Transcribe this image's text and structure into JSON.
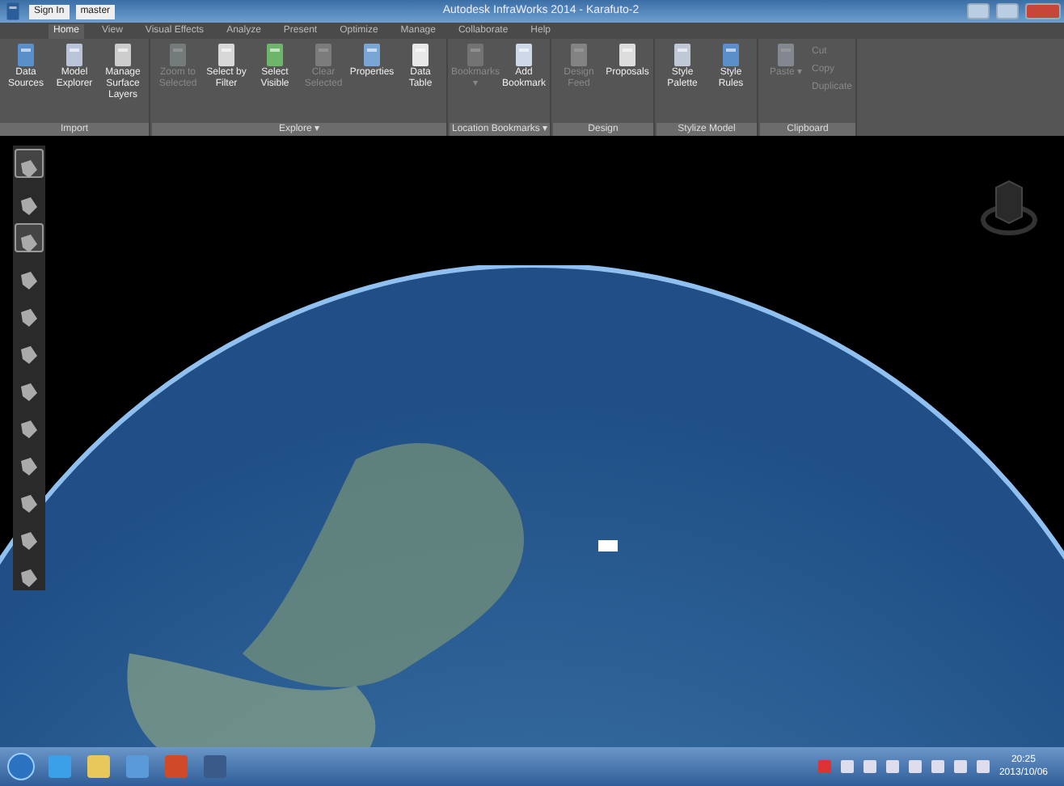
{
  "window": {
    "title": "Autodesk InfraWorks 2014 - Karafuto-2"
  },
  "quick_access": {
    "sign_in": "Sign In",
    "proposal": "master"
  },
  "tabs": [
    {
      "label": "Home",
      "selected": true
    },
    {
      "label": "View",
      "selected": false
    },
    {
      "label": "Visual Effects",
      "selected": false
    },
    {
      "label": "Analyze",
      "selected": false
    },
    {
      "label": "Present",
      "selected": false
    },
    {
      "label": "Optimize",
      "selected": false
    },
    {
      "label": "Manage",
      "selected": false
    },
    {
      "label": "Collaborate",
      "selected": false
    },
    {
      "label": "Help",
      "selected": false
    }
  ],
  "ribbon_groups": [
    {
      "label": "Import",
      "tools": [
        {
          "label": "Data Sources",
          "disabled": false
        },
        {
          "label": "Model Explorer",
          "disabled": false
        },
        {
          "label": "Manage Surface Layers",
          "disabled": false
        }
      ]
    },
    {
      "label": "Explore ▾",
      "tools": [
        {
          "label": "Zoom to Selected",
          "disabled": true
        },
        {
          "label": "Select by Filter",
          "disabled": false
        },
        {
          "label": "Select Visible",
          "disabled": false
        },
        {
          "label": "Clear Selected",
          "disabled": true
        },
        {
          "label": "Properties",
          "disabled": false
        },
        {
          "label": "Data Table",
          "disabled": false
        }
      ]
    },
    {
      "label": "Location Bookmarks ▾",
      "tools": [
        {
          "label": "Bookmarks ▾",
          "disabled": true
        },
        {
          "label": "Add Bookmark",
          "disabled": false
        }
      ]
    },
    {
      "label": "Design",
      "tools": [
        {
          "label": "Design Feed",
          "disabled": true
        },
        {
          "label": "Proposals",
          "disabled": false
        }
      ]
    },
    {
      "label": "Stylize Model",
      "tools": [
        {
          "label": "Style Palette",
          "disabled": false
        },
        {
          "label": "Style Rules",
          "disabled": false
        }
      ]
    },
    {
      "label": "Clipboard",
      "tools": [
        {
          "label": "Paste ▾",
          "disabled": true
        }
      ],
      "small_tools": [
        {
          "label": "Cut",
          "disabled": true
        },
        {
          "label": "Copy",
          "disabled": true
        },
        {
          "label": "Duplicate",
          "disabled": true
        }
      ]
    }
  ],
  "left_toolbar": [
    {
      "selected": true
    },
    {
      "selected": false
    },
    {
      "selected": true
    },
    {
      "selected": false
    },
    {
      "selected": false
    },
    {
      "selected": false
    },
    {
      "selected": false
    },
    {
      "selected": false
    },
    {
      "selected": false
    },
    {
      "selected": false
    },
    {
      "selected": false
    },
    {
      "selected": false
    }
  ],
  "taskbar": {
    "clock_time": "20:25",
    "clock_date": "2013/10/06"
  }
}
